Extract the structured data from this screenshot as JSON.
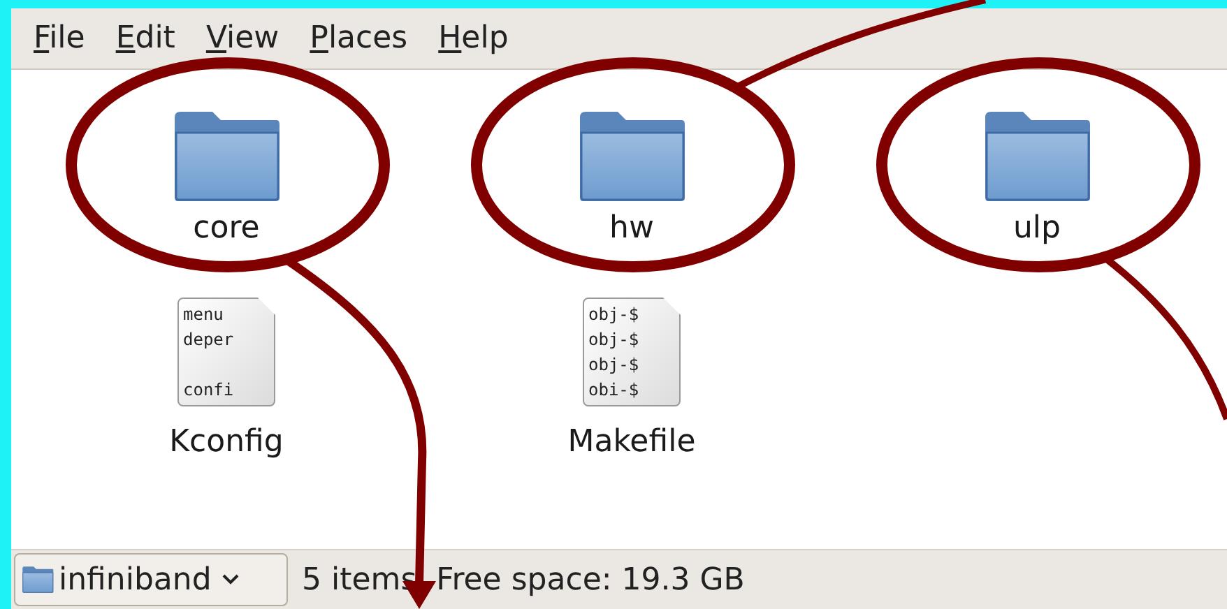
{
  "menu": [
    {
      "label": "File"
    },
    {
      "label": "Edit"
    },
    {
      "label": "View"
    },
    {
      "label": "Places"
    },
    {
      "label": "Help"
    }
  ],
  "items": [
    {
      "kind": "folder",
      "name": "core",
      "circled": true
    },
    {
      "kind": "folder",
      "name": "hw",
      "circled": true
    },
    {
      "kind": "folder",
      "name": "ulp",
      "circled": true
    },
    {
      "kind": "text-file",
      "name": "Kconfig",
      "preview_top": [
        "menu",
        "deper"
      ],
      "preview_bottom": [
        "confi"
      ]
    },
    {
      "kind": "text-file",
      "name": "Makefile",
      "preview_top": [
        "obj-$",
        "obj-$",
        "obj-$",
        "obi-$"
      ]
    }
  ],
  "status_bar": {
    "location": "infiniband",
    "item_count": "5 items",
    "free_space": "Free space: 19.3 GB"
  }
}
